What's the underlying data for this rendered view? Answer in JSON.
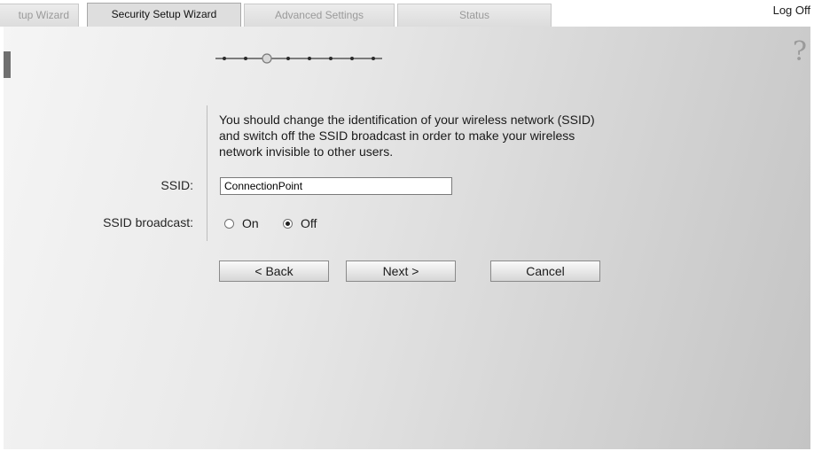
{
  "tabs": [
    {
      "label": "tup Wizard",
      "active": false
    },
    {
      "label": "Security Setup Wizard",
      "active": true
    },
    {
      "label": "Advanced Settings",
      "active": false
    },
    {
      "label": "Status",
      "active": false
    }
  ],
  "header": {
    "logoff_label": "Log Off"
  },
  "help": {
    "icon_glyph": "?",
    "icon": "help-icon"
  },
  "progress": {
    "total_steps": 8,
    "current_step": 3
  },
  "wizard": {
    "description": "You should change the identification of your wireless network (SSID) and switch off the SSID broadcast in order to make your wireless network invisible to other users.",
    "ssid_label": "SSID:",
    "ssid_value": "ConnectionPoint",
    "broadcast_label": "SSID broadcast:",
    "broadcast_options": [
      {
        "label": "On",
        "checked": false
      },
      {
        "label": "Off",
        "checked": true
      }
    ]
  },
  "buttons": {
    "back": "< Back",
    "next": "Next >",
    "cancel": "Cancel"
  },
  "colors": {
    "panel_light": "#f5f5f5",
    "panel_dark": "#c4c4c4",
    "text": "#1a1a1a",
    "inactive_tab_text": "#9a9a9a"
  }
}
